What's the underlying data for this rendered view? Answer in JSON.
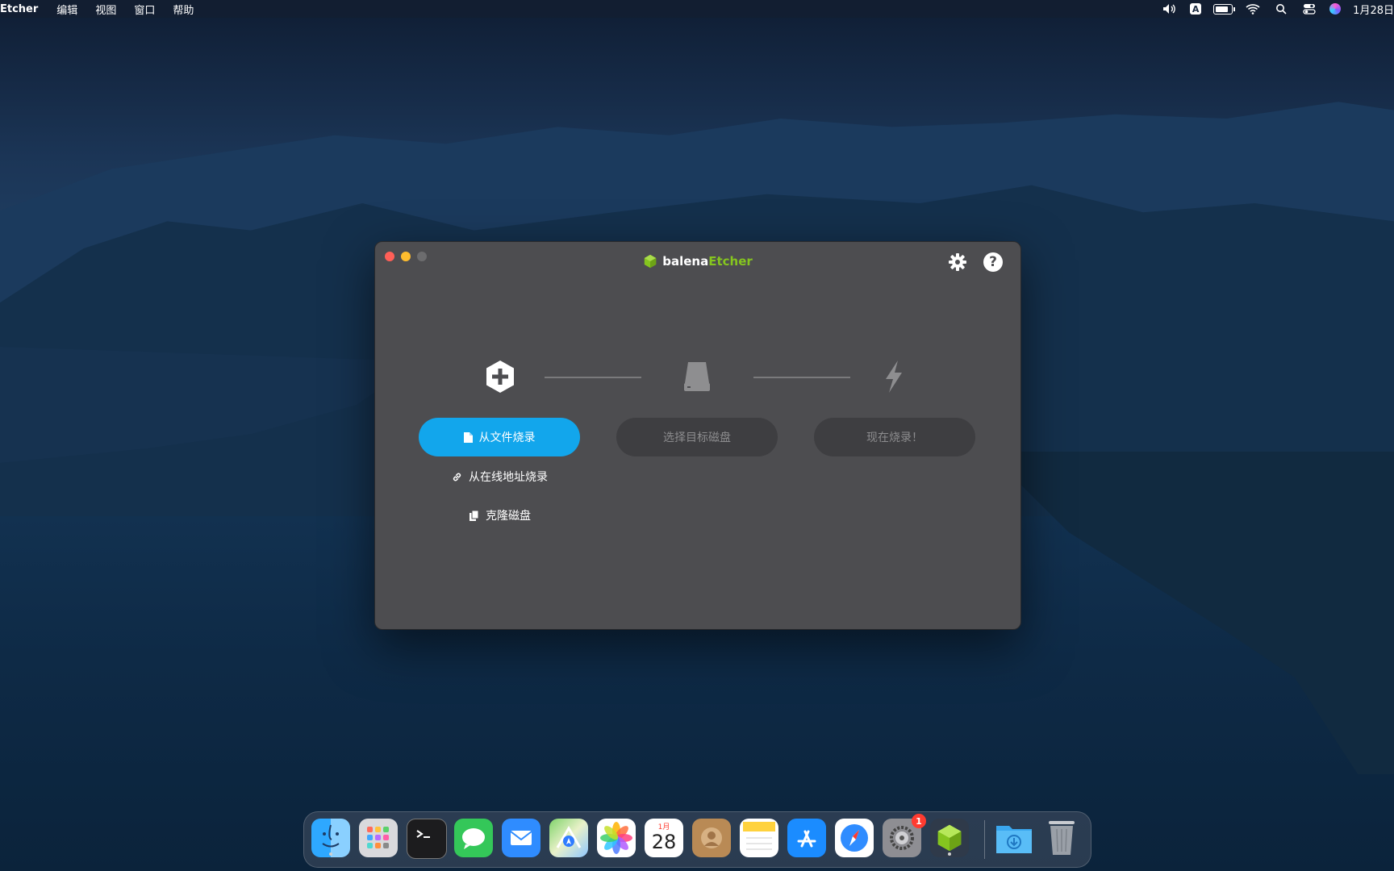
{
  "menubar": {
    "app_name": "Etcher",
    "items": [
      "编辑",
      "视图",
      "窗口",
      "帮助"
    ],
    "clock": "1月28日"
  },
  "window": {
    "logo": {
      "part1": "balena",
      "part2": "Etcher"
    },
    "colors": {
      "accent": "#12a6ec",
      "brand_green": "#85c51f",
      "window_bg": "#4d4d50"
    },
    "steps": [
      {
        "icon": "plus-hexagon-icon",
        "button_label": "从文件烧录",
        "state": "active"
      },
      {
        "icon": "drive-icon",
        "button_label": "选择目标磁盘",
        "state": "disabled"
      },
      {
        "icon": "flash-icon",
        "button_label": "现在烧录！",
        "state": "disabled"
      }
    ],
    "alt_actions": {
      "url": "从在线地址烧录",
      "clone": "克隆磁盘"
    }
  },
  "dock": {
    "apps": [
      {
        "name": "finder"
      },
      {
        "name": "launchpad"
      },
      {
        "name": "terminal"
      },
      {
        "name": "messages"
      },
      {
        "name": "mail"
      },
      {
        "name": "maps"
      },
      {
        "name": "photos"
      },
      {
        "name": "calendar",
        "month": "1月",
        "day": "28"
      },
      {
        "name": "contacts"
      },
      {
        "name": "notes"
      },
      {
        "name": "app-store"
      },
      {
        "name": "safari"
      },
      {
        "name": "system-preferences",
        "badge": "1"
      },
      {
        "name": "balena-etcher"
      }
    ]
  }
}
